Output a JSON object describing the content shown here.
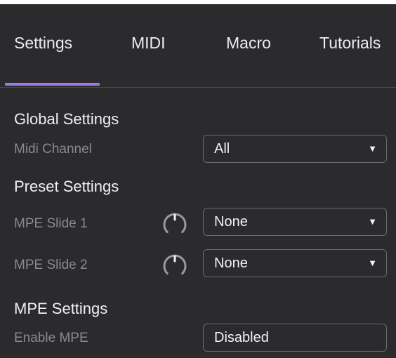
{
  "tabs": [
    {
      "label": "Settings",
      "active": true
    },
    {
      "label": "MIDI"
    },
    {
      "label": "Macro"
    },
    {
      "label": "Tutorials"
    }
  ],
  "global": {
    "title": "Global Settings",
    "midi_channel": {
      "label": "Midi Channel",
      "value": "All"
    }
  },
  "preset": {
    "title": "Preset Settings",
    "mpe_slide_1": {
      "label": "MPE Slide 1",
      "value": "None"
    },
    "mpe_slide_2": {
      "label": "MPE Slide 2",
      "value": "None"
    }
  },
  "mpe": {
    "title": "MPE Settings",
    "enable": {
      "label": "Enable MPE",
      "value": "Disabled"
    }
  },
  "colors": {
    "background": "#2b2b2d",
    "accent": "#9d7ae0",
    "label": "#8a8a8f",
    "border": "#6a6a6f"
  },
  "icons": {
    "dropdown": "triangle-down-icon",
    "knob": "knob-icon"
  }
}
